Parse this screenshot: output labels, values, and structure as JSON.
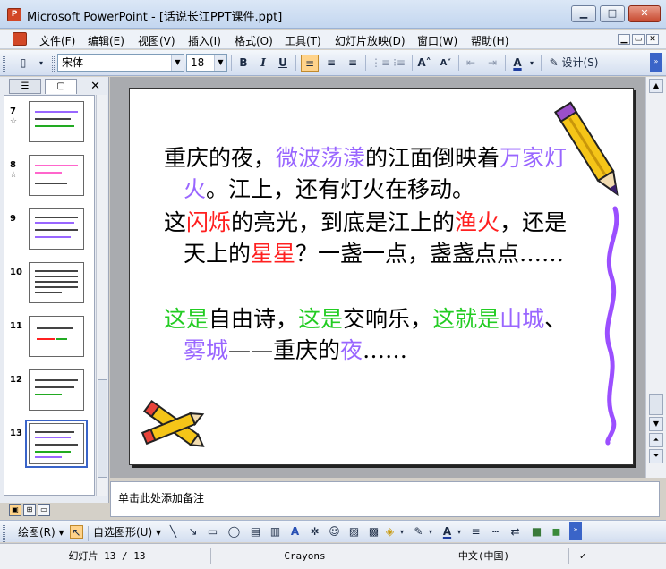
{
  "window": {
    "title": "Microsoft PowerPoint - [话说长江PPT课件.ppt]",
    "app_icon_label": "P",
    "minimize": "▁",
    "maximize": "□",
    "close": "✕"
  },
  "menu": {
    "items": [
      "文件(F)",
      "编辑(E)",
      "视图(V)",
      "插入(I)",
      "格式(O)",
      "工具(T)",
      "幻灯片放映(D)",
      "窗口(W)",
      "帮助(H)"
    ],
    "doc_min": "▁",
    "doc_restore": "▭",
    "doc_close": "✕"
  },
  "toolbar": {
    "font_name": "宋体",
    "font_size": "18",
    "bold": "B",
    "italic": "I",
    "underline": "U",
    "design_label": "设计(S)"
  },
  "left_panel": {
    "tab_outline": "☰",
    "tab_slides": "▢",
    "close": "✕",
    "thumbnails": [
      {
        "num": "7",
        "star": "☆"
      },
      {
        "num": "8",
        "star": "☆"
      },
      {
        "num": "9",
        "star": ""
      },
      {
        "num": "10",
        "star": ""
      },
      {
        "num": "11",
        "star": ""
      },
      {
        "num": "12",
        "star": ""
      },
      {
        "num": "13",
        "star": ""
      }
    ]
  },
  "slide": {
    "p1": {
      "a": "重庆的夜，",
      "b": "微波荡漾",
      "c": "的江面倒映着",
      "d": "万家灯火",
      "e": "。江上，还有灯火在移动。"
    },
    "p2": {
      "a": "这",
      "b": "闪烁",
      "c": "的亮光，到底是江上的",
      "d": "渔火",
      "e": "，还是天上的",
      "f": "星星",
      "g": "？一盏一点，盏盏点点……"
    },
    "p3": {
      "a": "这是",
      "b": "自由诗，",
      "c": "这是",
      "d": "交响乐，",
      "e": "这就是",
      "f": "山城",
      "g": "、",
      "h": "雾城",
      "i": "——重庆的",
      "j": "夜",
      "k": "……"
    }
  },
  "notes": {
    "placeholder": "单击此处添加备注"
  },
  "drawbar": {
    "draw_label": "绘图(R)",
    "autoshapes_label": "自选图形(U)"
  },
  "status": {
    "slide_info": "幻灯片 13 / 13",
    "design": "Crayons",
    "language": "中文(中国)"
  },
  "colors": {
    "purple": "#9966ff",
    "red": "#ff2020",
    "green": "#22cc22"
  }
}
